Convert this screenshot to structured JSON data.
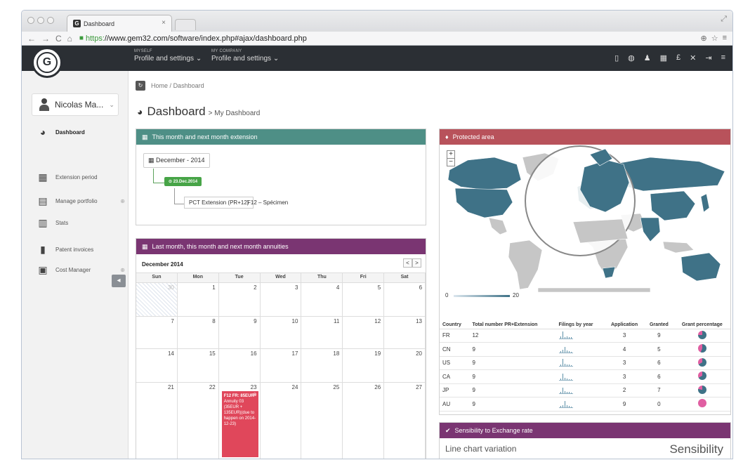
{
  "browser": {
    "tab_title": "Dashboard",
    "tab_close": "×",
    "url_scheme": "https:",
    "url_rest": "//www.gem32.com/software/index.php#ajax/dashboard.php"
  },
  "topbar": {
    "logo_letter": "G",
    "menu1_small": "MYSELF",
    "menu1_label": "Profile and settings ⌄",
    "menu2_small": "MY COMPANY",
    "menu2_label": "Profile and settings ⌄"
  },
  "sidebar": {
    "user_name": "Nicolas Ma...",
    "items": [
      {
        "label": "Dashboard",
        "icon": "dashboard-icon"
      },
      {
        "label": "Extension period",
        "icon": "calendar-icon"
      },
      {
        "label": "Manage portfolio",
        "icon": "table-icon"
      },
      {
        "label": "Stats",
        "icon": "chart-icon"
      },
      {
        "label": "Patent invoices",
        "icon": "document-icon"
      },
      {
        "label": "Cost Manager",
        "icon": "money-icon"
      }
    ],
    "plus_sign": "⊕"
  },
  "breadcrumb": {
    "home": "Home",
    "sep": "/",
    "current": "Dashboard"
  },
  "page": {
    "title": "Dashboard",
    "subtitle": "> My Dashboard"
  },
  "extension_panel": {
    "title": "This month and next month extension",
    "month": "December - 2014",
    "date_badge": "23.Dec.2014",
    "item": "PCT Extension (PR+12)",
    "item_detail": "F12 – Spécimen"
  },
  "calendar_panel": {
    "title": "Last month, this month and next month annuities",
    "month_label": "December 2014",
    "prev": "<",
    "next": ">",
    "weekdays": [
      "Sun",
      "Mon",
      "Tue",
      "Wed",
      "Thu",
      "Fri",
      "Sat"
    ],
    "weeks": [
      [
        "30",
        "1",
        "2",
        "3",
        "4",
        "5",
        "6"
      ],
      [
        "7",
        "8",
        "9",
        "10",
        "11",
        "12",
        "13"
      ],
      [
        "14",
        "15",
        "16",
        "17",
        "18",
        "19",
        "20"
      ],
      [
        "21",
        "22",
        "23",
        "24",
        "25",
        "26",
        "27"
      ]
    ],
    "event": {
      "title": "F12 FR: 85EUR",
      "body": "Annuity 03 (35EUR + 135EUR)(due to happen on 2014-12-23)"
    }
  },
  "map_panel": {
    "title": "Protected area",
    "zoom_in": "+",
    "zoom_out": "−",
    "legend_min": "0",
    "legend_max": "20",
    "land_color": "#c6c6c6",
    "protected_color": "#3f7287",
    "columns": [
      "Country",
      "Total number PR+Extension",
      "Filings by year",
      "Application",
      "Granted",
      "Grant percentage"
    ],
    "rows": [
      {
        "country": "FR",
        "total": "12",
        "application": "3",
        "granted": "9",
        "grant_fraction": 0.75
      },
      {
        "country": "CN",
        "total": "9",
        "application": "4",
        "granted": "5",
        "grant_fraction": 0.56
      },
      {
        "country": "US",
        "total": "9",
        "application": "3",
        "granted": "6",
        "grant_fraction": 0.67
      },
      {
        "country": "CA",
        "total": "9",
        "application": "3",
        "granted": "6",
        "grant_fraction": 0.67
      },
      {
        "country": "JP",
        "total": "9",
        "application": "2",
        "granted": "7",
        "grant_fraction": 0.78
      },
      {
        "country": "AU",
        "total": "9",
        "application": "9",
        "granted": "0",
        "grant_fraction": 0
      }
    ]
  },
  "sensibility_panel": {
    "title": "Sensibility to Exchange rate",
    "left_label": "Line chart variation",
    "right_label": "Sensibility"
  }
}
